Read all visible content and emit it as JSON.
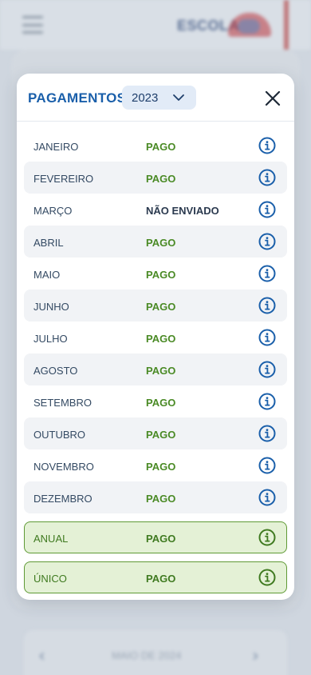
{
  "background": {
    "logo_text": "ESCOLA",
    "calendar_label": "MAIO DE 2024",
    "prev_icon": "chevron-left-icon",
    "next_icon": "chevron-right-icon"
  },
  "modal": {
    "title": "PAGAMENTOS",
    "year": "2023",
    "close_icon": "close-icon",
    "months": [
      {
        "label": "JANEIRO",
        "status": "PAGO"
      },
      {
        "label": "FEVEREIRO",
        "status": "PAGO"
      },
      {
        "label": "MARÇO",
        "status": "NÃO ENVIADO"
      },
      {
        "label": "ABRIL",
        "status": "PAGO"
      },
      {
        "label": "MAIO",
        "status": "PAGO"
      },
      {
        "label": "JUNHO",
        "status": "PAGO"
      },
      {
        "label": "JULHO",
        "status": "PAGO"
      },
      {
        "label": "AGOSTO",
        "status": "PAGO"
      },
      {
        "label": "SETEMBRO",
        "status": "PAGO"
      },
      {
        "label": "OUTUBRO",
        "status": "PAGO"
      },
      {
        "label": "NOVEMBRO",
        "status": "PAGO"
      },
      {
        "label": "DEZEMBRO",
        "status": "PAGO"
      }
    ],
    "summary": [
      {
        "label": "ANUAL",
        "status": "PAGO"
      },
      {
        "label": "ÚNICO",
        "status": "PAGO"
      }
    ]
  },
  "colors": {
    "title_blue": "#1a5faa",
    "paid_green": "#4a8a25",
    "summary_bg": "#e4f1d6",
    "summary_border": "#5f9a35",
    "info_icon_blue": "#1a5faa"
  }
}
